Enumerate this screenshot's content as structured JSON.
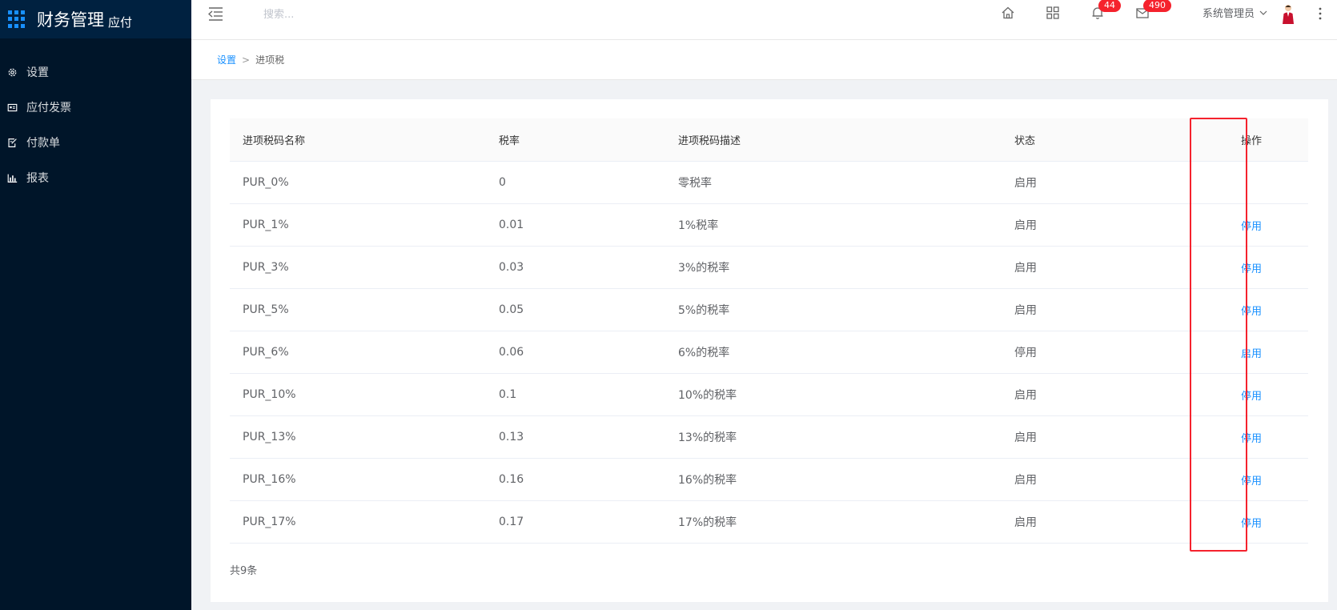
{
  "app": {
    "title": "财务管理",
    "subtitle": "应付"
  },
  "sidebar": {
    "items": [
      {
        "label": "设置",
        "icon": "gear-icon"
      },
      {
        "label": "应付发票",
        "icon": "invoice-icon"
      },
      {
        "label": "付款单",
        "icon": "payment-icon"
      },
      {
        "label": "报表",
        "icon": "chart-icon"
      }
    ]
  },
  "header": {
    "search_placeholder": "搜索...",
    "notifications_count": "44",
    "messages_count": "490",
    "user_name": "系统管理员"
  },
  "breadcrumb": {
    "parent": "设置",
    "separator": ">",
    "current": "进项税"
  },
  "table": {
    "columns": [
      "进项税码名称",
      "税率",
      "进项税码描述",
      "状态",
      "操作"
    ],
    "rows": [
      {
        "name": "PUR_0%",
        "rate": "0",
        "desc": "零税率",
        "status": "启用",
        "action": ""
      },
      {
        "name": "PUR_1%",
        "rate": "0.01",
        "desc": "1%税率",
        "status": "启用",
        "action": "停用"
      },
      {
        "name": "PUR_3%",
        "rate": "0.03",
        "desc": "3%的税率",
        "status": "启用",
        "action": "停用"
      },
      {
        "name": "PUR_5%",
        "rate": "0.05",
        "desc": "5%的税率",
        "status": "启用",
        "action": "停用"
      },
      {
        "name": "PUR_6%",
        "rate": "0.06",
        "desc": "6%的税率",
        "status": "停用",
        "action": "启用"
      },
      {
        "name": "PUR_10%",
        "rate": "0.1",
        "desc": "10%的税率",
        "status": "启用",
        "action": "停用"
      },
      {
        "name": "PUR_13%",
        "rate": "0.13",
        "desc": "13%的税率",
        "status": "启用",
        "action": "停用"
      },
      {
        "name": "PUR_16%",
        "rate": "0.16",
        "desc": "16%的税率",
        "status": "启用",
        "action": "停用"
      },
      {
        "name": "PUR_17%",
        "rate": "0.17",
        "desc": "17%的税率",
        "status": "启用",
        "action": "停用"
      }
    ],
    "total": "共9条"
  },
  "colors": {
    "sidebar_bg": "#001529",
    "accent": "#1890ff",
    "badge": "#f5222d",
    "highlight_box": "#f5222d"
  }
}
